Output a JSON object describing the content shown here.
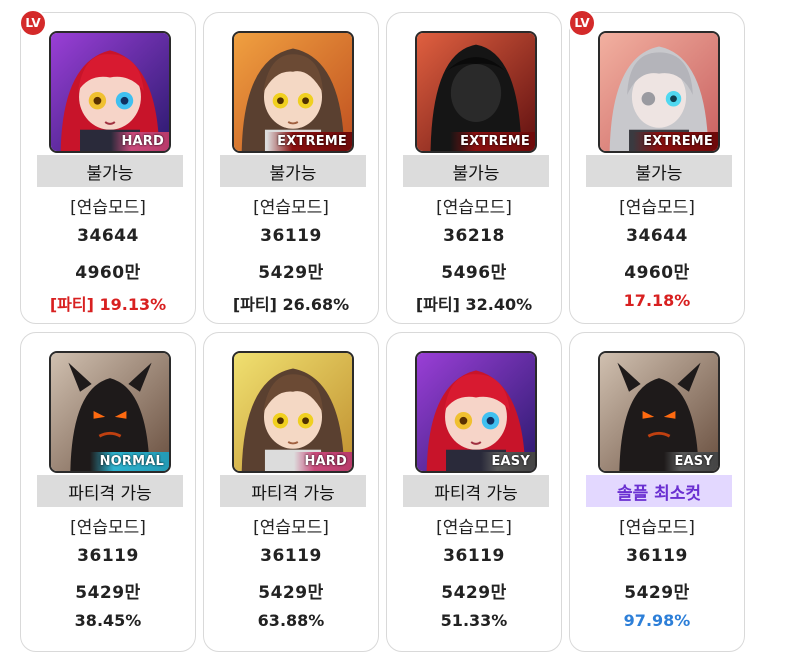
{
  "lv_badge": "LV",
  "mode_label": "[연습모드]",
  "cards": [
    {
      "status": "불가능",
      "number": "34644",
      "amount": "4960만",
      "percent": "[파티] 19.13%",
      "percent_color": "#d82020",
      "difficulty": "HARD",
      "has_lv": true,
      "portrait": "red-haired-girl-icon"
    },
    {
      "status": "불가능",
      "number": "36119",
      "amount": "5429만",
      "percent": "[파티] 26.68%",
      "percent_color": "#222222",
      "difficulty": "EXTREME",
      "has_lv": false,
      "portrait": "brown-haired-woman-icon"
    },
    {
      "status": "불가능",
      "number": "36218",
      "amount": "5496만",
      "percent": "[파티] 32.40%",
      "percent_color": "#222222",
      "difficulty": "EXTREME",
      "has_lv": false,
      "portrait": "hooded-shadow-icon"
    },
    {
      "status": "불가능",
      "number": "34644",
      "amount": "4960만",
      "percent": "17.18%",
      "percent_color": "#d82020",
      "difficulty": "EXTREME",
      "has_lv": true,
      "portrait": "silver-haired-figure-icon"
    },
    {
      "status": "파티격 가능",
      "number": "36119",
      "amount": "5429만",
      "percent": "38.45%",
      "percent_color": "#222222",
      "difficulty": "NORMAL",
      "has_lv": false,
      "portrait": "dark-demon-icon"
    },
    {
      "status": "파티격 가능",
      "number": "36119",
      "amount": "5429만",
      "percent": "63.88%",
      "percent_color": "#222222",
      "difficulty": "HARD",
      "has_lv": false,
      "portrait": "brown-haired-woman-icon"
    },
    {
      "status": "파티격 가능",
      "number": "36119",
      "amount": "5429만",
      "percent": "51.33%",
      "percent_color": "#222222",
      "difficulty": "EASY",
      "has_lv": false,
      "portrait": "red-haired-girl-icon"
    },
    {
      "status": "솔플 최소컷",
      "number": "36119",
      "amount": "5429만",
      "percent": "97.98%",
      "percent_color": "#2d7fd8",
      "difficulty": "EASY",
      "has_lv": false,
      "portrait": "dark-demon-icon"
    }
  ]
}
